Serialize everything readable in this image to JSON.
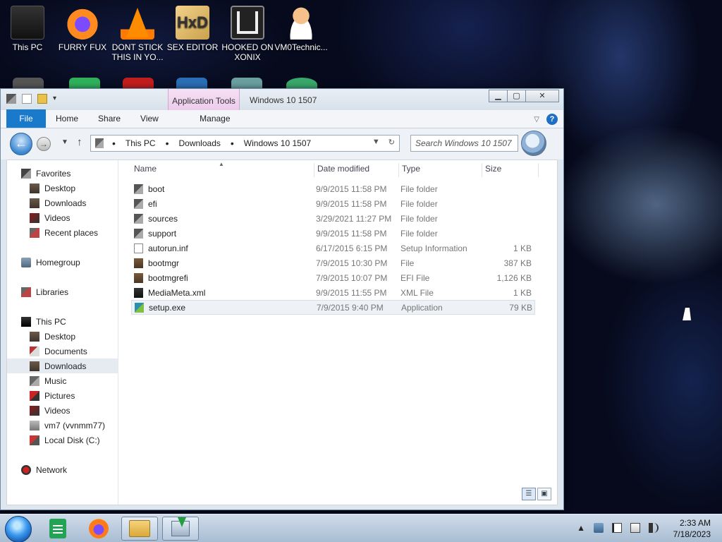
{
  "desktop": {
    "icons": [
      {
        "label": "This PC",
        "icon": "this-pc-icon"
      },
      {
        "label": "FURRY FUX",
        "icon": "firefox-icon"
      },
      {
        "label": "DONT STICK THIS IN YO...",
        "icon": "vlc-cone-icon"
      },
      {
        "label": "SEX EDITOR",
        "icon": "hxd-icon"
      },
      {
        "label": "HOOKED ON XONIX",
        "icon": "xonix-icon"
      },
      {
        "label": "VM0Technic...",
        "icon": "doctor-icon"
      }
    ]
  },
  "window": {
    "contextual_tab": "Application Tools",
    "title": "Windows 10 1507",
    "caption": {
      "minimize": "▁",
      "maximize": "▢",
      "close": "✕"
    },
    "ribbon_tabs": [
      "File",
      "Home",
      "Share",
      "View",
      "Manage"
    ],
    "breadcrumbs": [
      "This PC",
      "Downloads",
      "Windows 10 1507"
    ],
    "search_placeholder": "Search Windows 10 1507",
    "nav_pane": {
      "favorites": {
        "label": "Favorites",
        "items": [
          "Desktop",
          "Downloads",
          "Videos",
          "Recent places"
        ]
      },
      "homegroup": "Homegroup",
      "libraries": "Libraries",
      "this_pc": {
        "label": "This PC",
        "items": [
          "Desktop",
          "Documents",
          "Downloads",
          "Music",
          "Pictures",
          "Videos",
          "vm7 (vvnmm77)",
          "Local Disk (C:)"
        ]
      },
      "network": "Network"
    },
    "columns": {
      "name": "Name",
      "date": "Date modified",
      "type": "Type",
      "size": "Size"
    },
    "files": [
      {
        "name": "boot",
        "date": "9/9/2015 11:58 PM",
        "type": "File folder",
        "size": "",
        "icon": "folder-icon"
      },
      {
        "name": "efi",
        "date": "9/9/2015 11:58 PM",
        "type": "File folder",
        "size": "",
        "icon": "folder-icon"
      },
      {
        "name": "sources",
        "date": "3/29/2021 11:27 PM",
        "type": "File folder",
        "size": "",
        "icon": "folder-icon"
      },
      {
        "name": "support",
        "date": "9/9/2015 11:58 PM",
        "type": "File folder",
        "size": "",
        "icon": "folder-icon"
      },
      {
        "name": "autorun.inf",
        "date": "6/17/2015 6:15 PM",
        "type": "Setup Information",
        "size": "1 KB",
        "icon": "inf-file-icon"
      },
      {
        "name": "bootmgr",
        "date": "7/9/2015 10:30 PM",
        "type": "File",
        "size": "387 KB",
        "icon": "file-icon"
      },
      {
        "name": "bootmgrefi",
        "date": "7/9/2015 10:07 PM",
        "type": "EFI File",
        "size": "1,126 KB",
        "icon": "file-icon"
      },
      {
        "name": "MediaMeta.xml",
        "date": "9/9/2015 11:55 PM",
        "type": "XML File",
        "size": "1 KB",
        "icon": "xml-file-icon"
      },
      {
        "name": "setup.exe",
        "date": "7/9/2015 9:40 PM",
        "type": "Application",
        "size": "79 KB",
        "icon": "setup-exe-icon"
      }
    ]
  },
  "taskbar": {
    "time": "2:33 AM",
    "date": "7/18/2023"
  }
}
